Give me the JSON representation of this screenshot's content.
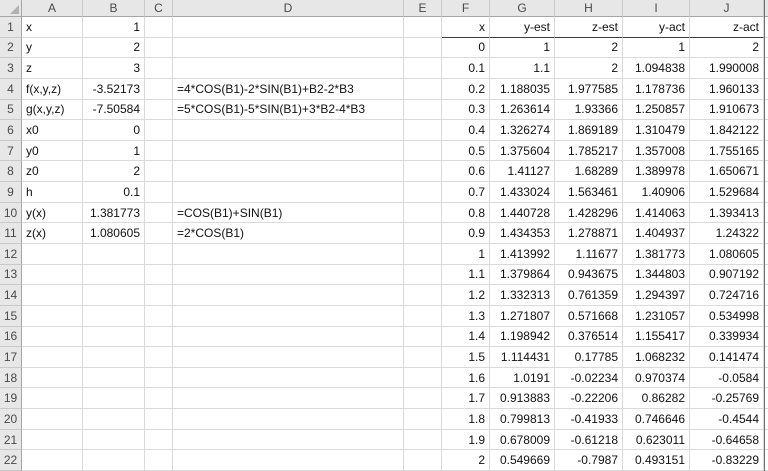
{
  "grid": {
    "column_headers": [
      "A",
      "B",
      "C",
      "D",
      "E",
      "F",
      "G",
      "H",
      "I",
      "J"
    ],
    "row_headers": [
      "1",
      "2",
      "3",
      "4",
      "5",
      "6",
      "7",
      "8",
      "9",
      "10",
      "11",
      "12",
      "13",
      "14",
      "15",
      "16",
      "17",
      "18",
      "19",
      "20",
      "21",
      "22"
    ]
  },
  "left_block": {
    "labels": [
      "x",
      "y",
      "z",
      "f(x,y,z)",
      "g(x,y,z)",
      "x0",
      "y0",
      "z0",
      "h",
      "y(x)",
      "z(x)"
    ],
    "values": [
      "1",
      "2",
      "3",
      "-3.52173",
      "-7.50584",
      "0",
      "1",
      "2",
      "0.1",
      "1.381773",
      "1.080605"
    ],
    "formulas": {
      "4": "=4*COS(B1)-2*SIN(B1)+B2-2*B3",
      "5": "=5*COS(B1)-5*SIN(B1)+3*B2-4*B3",
      "10": "=COS(B1)+SIN(B1)",
      "11": "=2*COS(B1)"
    }
  },
  "right_table": {
    "headers": [
      "x",
      "y-est",
      "z-est",
      "y-act",
      "z-act"
    ],
    "rows": [
      [
        "0",
        "1",
        "2",
        "1",
        "2"
      ],
      [
        "0.1",
        "1.1",
        "2",
        "1.094838",
        "1.990008"
      ],
      [
        "0.2",
        "1.188035",
        "1.977585",
        "1.178736",
        "1.960133"
      ],
      [
        "0.3",
        "1.263614",
        "1.93366",
        "1.250857",
        "1.910673"
      ],
      [
        "0.4",
        "1.326274",
        "1.869189",
        "1.310479",
        "1.842122"
      ],
      [
        "0.5",
        "1.375604",
        "1.785217",
        "1.357008",
        "1.755165"
      ],
      [
        "0.6",
        "1.41127",
        "1.68289",
        "1.389978",
        "1.650671"
      ],
      [
        "0.7",
        "1.433024",
        "1.563461",
        "1.40906",
        "1.529684"
      ],
      [
        "0.8",
        "1.440728",
        "1.428296",
        "1.414063",
        "1.393413"
      ],
      [
        "0.9",
        "1.434353",
        "1.278871",
        "1.404937",
        "1.24322"
      ],
      [
        "1",
        "1.413992",
        "1.11677",
        "1.381773",
        "1.080605"
      ],
      [
        "1.1",
        "1.379864",
        "0.943675",
        "1.344803",
        "0.907192"
      ],
      [
        "1.2",
        "1.332313",
        "0.761359",
        "1.294397",
        "0.724716"
      ],
      [
        "1.3",
        "1.271807",
        "0.571668",
        "1.231057",
        "0.534998"
      ],
      [
        "1.4",
        "1.198942",
        "0.376514",
        "1.155417",
        "0.339934"
      ],
      [
        "1.5",
        "1.114431",
        "0.17785",
        "1.068232",
        "0.141474"
      ],
      [
        "1.6",
        "1.0191",
        "-0.02234",
        "0.970374",
        "-0.0584"
      ],
      [
        "1.7",
        "0.913883",
        "-0.22206",
        "0.86282",
        "-0.25769"
      ],
      [
        "1.8",
        "0.799813",
        "-0.41933",
        "0.746646",
        "-0.4544"
      ],
      [
        "1.9",
        "0.678009",
        "-0.61218",
        "0.623011",
        "-0.64658"
      ],
      [
        "2",
        "0.549669",
        "-0.7987",
        "0.493151",
        "-0.83229"
      ]
    ]
  }
}
